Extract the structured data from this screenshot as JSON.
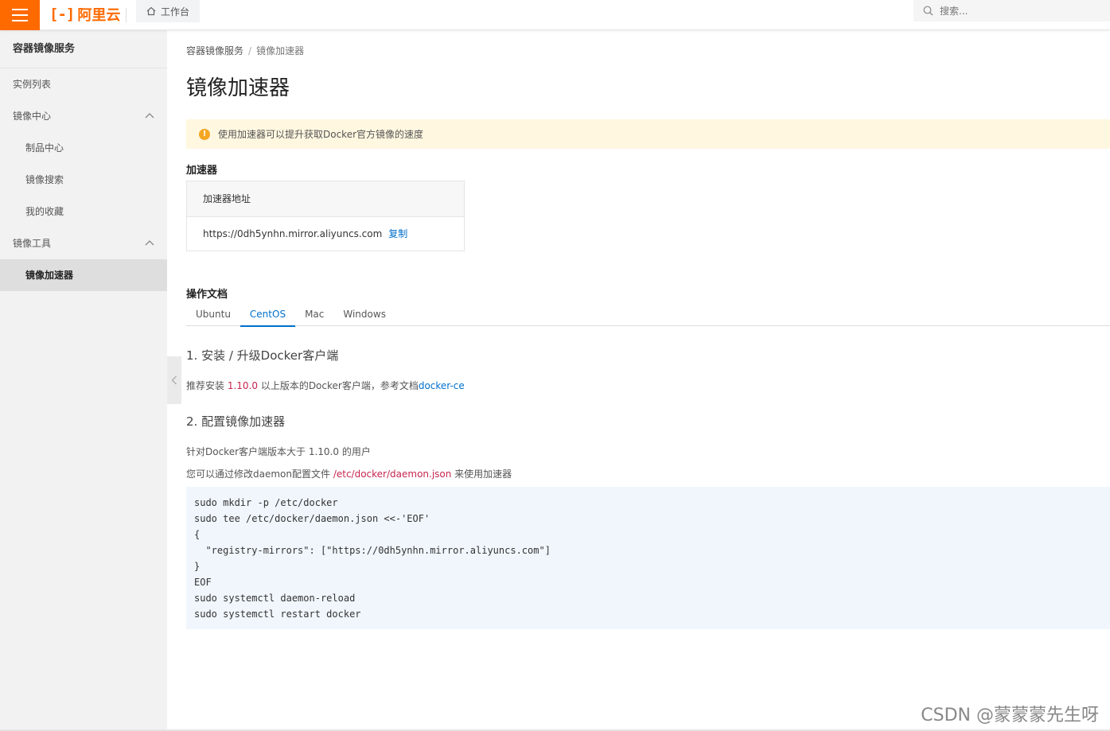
{
  "topbar": {
    "logo_mark": "[-]",
    "logo_text": "阿里云",
    "workbench_label": "工作台",
    "search_placeholder": "搜索..."
  },
  "sidebar": {
    "title": "容器镜像服务",
    "items": [
      {
        "label": "实例列表"
      },
      {
        "label": "镜像中心"
      },
      {
        "label": "制品中心"
      },
      {
        "label": "镜像搜索"
      },
      {
        "label": "我的收藏"
      },
      {
        "label": "镜像工具"
      },
      {
        "label": "镜像加速器"
      }
    ]
  },
  "breadcrumb": {
    "root": "容器镜像服务",
    "sep": "/",
    "current": "镜像加速器"
  },
  "page_title": "镜像加速器",
  "notice": "使用加速器可以提升获取Docker官方镜像的速度",
  "accelerator": {
    "heading": "加速器",
    "table_header": "加速器地址",
    "address": "https://0dh5ynhn.mirror.aliyuncs.com",
    "copy_label": "复制"
  },
  "docs": {
    "heading": "操作文档",
    "tabs": [
      "Ubuntu",
      "CentOS",
      "Mac",
      "Windows"
    ],
    "active_tab": "CentOS",
    "step1_title": "1. 安装 / 升级Docker客户端",
    "step1_prefix": "推荐安装 ",
    "step1_version": "1.10.0",
    "step1_mid": " 以上版本的Docker客户端，参考文档",
    "step1_link": "docker-ce",
    "step2_title": "2. 配置镜像加速器",
    "step2_p1": "针对Docker客户端版本大于 1.10.0 的用户",
    "step2_p2_prefix": "您可以通过修改daemon配置文件 ",
    "step2_p2_path": "/etc/docker/daemon.json",
    "step2_p2_suffix": " 来使用加速器",
    "code_lines": [
      "sudo mkdir -p /etc/docker",
      "sudo tee /etc/docker/daemon.json <<-'EOF'",
      "{",
      "  \"registry-mirrors\": [\"https://0dh5ynhn.mirror.aliyuncs.com\"]",
      "}",
      "EOF",
      "sudo systemctl daemon-reload",
      "sudo systemctl restart docker"
    ]
  },
  "watermark": "CSDN @蒙蒙蒙先生呀",
  "colors": {
    "brand": "#ff6a00",
    "link": "#0070cc",
    "accent_red": "#c7254e",
    "notice_bg": "#fff7e0"
  }
}
